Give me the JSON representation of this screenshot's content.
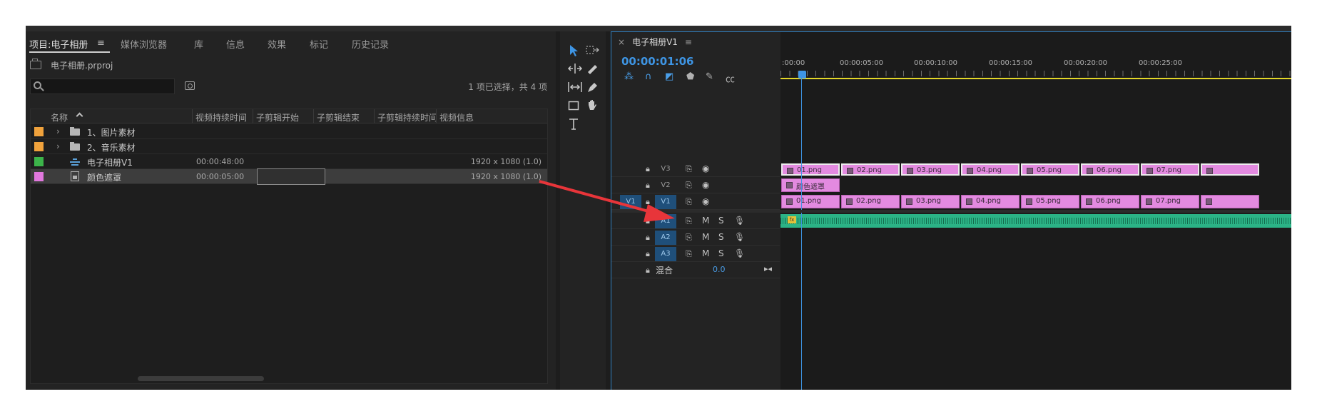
{
  "project_panel": {
    "tabs": [
      {
        "label": "项目:电子相册",
        "active": true
      },
      {
        "label": "媒体浏览器"
      },
      {
        "label": "库"
      },
      {
        "label": "信息"
      },
      {
        "label": "效果"
      },
      {
        "label": "标记"
      },
      {
        "label": "历史记录"
      }
    ],
    "menu_icon": "≡",
    "project_file": "电子相册.prproj",
    "search": {
      "value": "",
      "placeholder": ""
    },
    "selection_status": "1 项已选择，共 4 项",
    "columns": [
      "名称",
      "视频持续时间",
      "子剪辑开始",
      "子剪辑结束",
      "子剪辑持续时间",
      "视频信息"
    ],
    "items": [
      {
        "swatch": "#f0a23c",
        "type": "folder",
        "name": "1、图片素材",
        "duration": "",
        "info": ""
      },
      {
        "swatch": "#f0a23c",
        "type": "folder",
        "name": "2、音乐素材",
        "duration": "",
        "info": ""
      },
      {
        "swatch": "#3cb44a",
        "type": "sequence",
        "name": "电子相册V1",
        "duration": "00:00:48:00",
        "info": "1920 x 1080 (1.0)"
      },
      {
        "swatch": "#e178de",
        "type": "color-matte",
        "name": "颜色遮罩",
        "duration": "00:00:05:00",
        "info": "1920 x 1080 (1.0)",
        "selected": true
      }
    ]
  },
  "tools": [
    "selection-arrow",
    "track-select",
    "ripple-edit",
    "razor",
    "slip",
    "pen",
    "rectangle",
    "hand",
    "type"
  ],
  "timeline": {
    "title": "电子相册V1",
    "close": "×",
    "menu_icon": "≡",
    "timecode": "00:00:01:06",
    "ruler_labels": [
      ":00:00",
      "00:00:05:00",
      "00:00:10:00",
      "00:00:15:00",
      "00:00:20:00",
      "00:00:25:00"
    ],
    "tracks": {
      "V3": {
        "name": "V3",
        "clips": [
          "01.png",
          "02.png",
          "03.png",
          "04.png",
          "05.png",
          "06.png",
          "07.png",
          ""
        ]
      },
      "V2": {
        "name": "V2",
        "clips": [
          "颜色遮罩"
        ]
      },
      "V1": {
        "name": "V1",
        "source": "V1",
        "clips": [
          "01.png",
          "02.png",
          "03.png",
          "04.png",
          "05.png",
          "06.png",
          "07.png",
          ""
        ]
      },
      "A1": {
        "name": "A1"
      },
      "A2": {
        "name": "A2"
      },
      "A3": {
        "name": "A3"
      }
    },
    "mix_label": "混合",
    "mix_value": "0.0",
    "m_label": "M",
    "s_label": "S"
  },
  "colors": {
    "accent": "#3e95e4",
    "clip_pink": "#e38ae0",
    "audio_green": "#2bb386",
    "annotation_red": "#e8353a"
  }
}
